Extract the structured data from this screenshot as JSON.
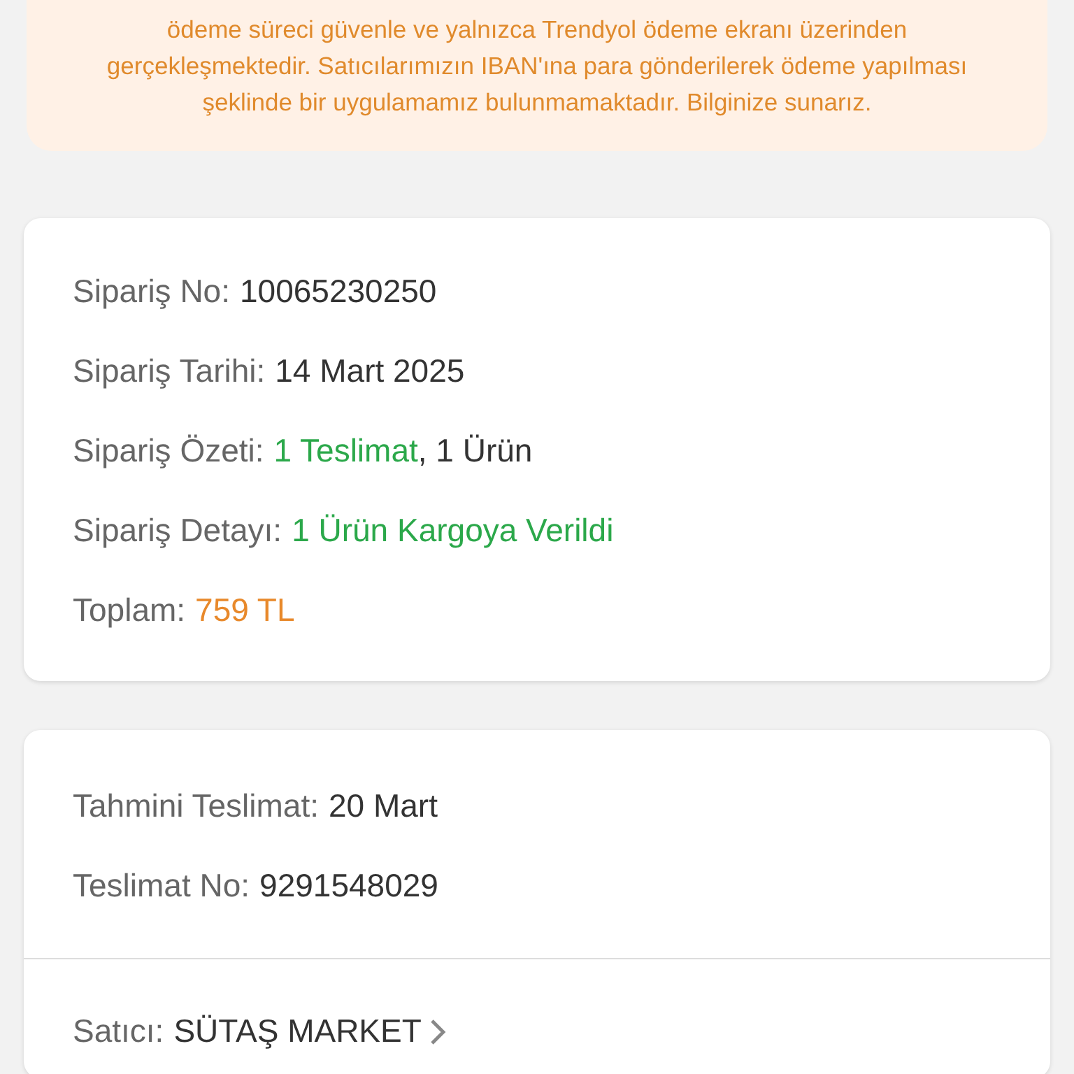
{
  "notice": {
    "text": "ödeme süreci güvenle ve yalnızca Trendyol ödeme ekranı üzerinden gerçekleşmektedir. Satıcılarımızın IBAN'ına para gönderilerek ödeme yapılması şeklinde bir uygulamamız bulunmamaktadır. Bilginize sunarız."
  },
  "order": {
    "rows": [
      {
        "label": "Sipariş No:",
        "parts": [
          {
            "text": "10065230250",
            "color": "#333333"
          }
        ]
      },
      {
        "label": "Sipariş Tarihi:",
        "parts": [
          {
            "text": "14 Mart 2025",
            "color": "#333333"
          }
        ]
      },
      {
        "label": "Sipariş Özeti:",
        "parts": [
          {
            "text": "1 Teslimat",
            "color": "#2ba84a"
          },
          {
            "text": ", 1 Ürün",
            "color": "#333333"
          }
        ]
      },
      {
        "label": "Sipariş Detayı:",
        "parts": [
          {
            "text": "1 Ürün Kargoya Verildi",
            "color": "#2ba84a"
          }
        ]
      },
      {
        "label": "Toplam:",
        "parts": [
          {
            "text": "759 TL",
            "color": "#e8892b"
          }
        ]
      }
    ]
  },
  "delivery": {
    "rows": [
      {
        "label": "Tahmini Teslimat:",
        "parts": [
          {
            "text": "20 Mart",
            "color": "#333333"
          }
        ]
      },
      {
        "label": "Teslimat No:",
        "parts": [
          {
            "text": "9291548029",
            "color": "#333333"
          }
        ]
      }
    ],
    "seller": {
      "label": "Satıcı:",
      "name": "SÜTAŞ MARKET"
    }
  }
}
